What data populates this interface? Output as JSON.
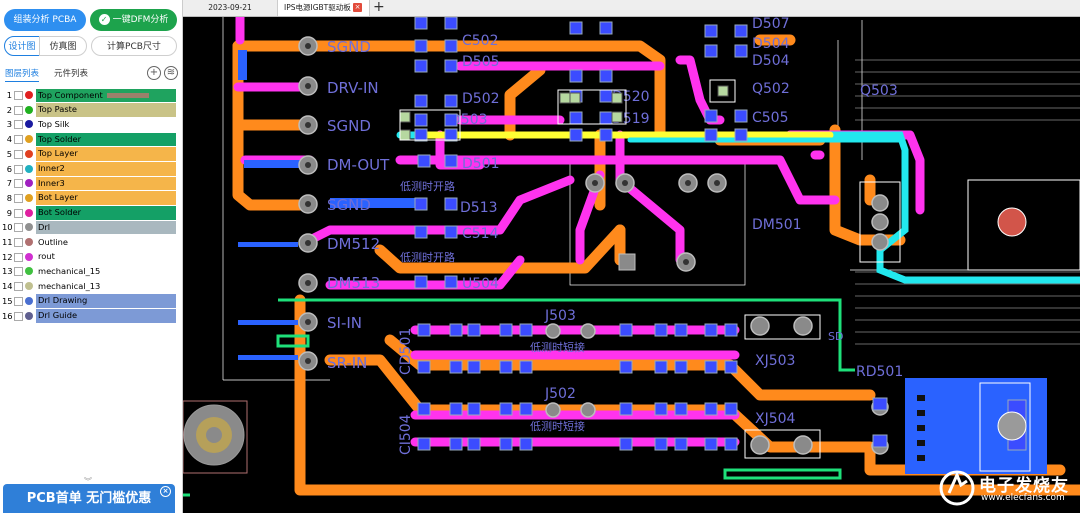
{
  "sidebar": {
    "pcba_button": "组装分析 PCBA",
    "dfm_button": "一键DFM分析",
    "view_tabs": [
      "设计图",
      "仿真图"
    ],
    "calc_button": "计算PCB尺寸",
    "list_tabs": [
      "图层列表",
      "元件列表"
    ],
    "layers": [
      {
        "num": "1",
        "name": "Top Component",
        "dot": "#e02020",
        "bg": "#1fa35f",
        "color": "#000"
      },
      {
        "num": "2",
        "name": "Top Paste",
        "dot": "#20b020",
        "bg": "#c9c387",
        "color": "#000"
      },
      {
        "num": "3",
        "name": "Top Silk",
        "dot": "#1a1aa0",
        "bg": "",
        "color": "#000"
      },
      {
        "num": "4",
        "name": "Top Solder",
        "dot": "#e0a020",
        "bg": "#14a066",
        "color": "#000"
      },
      {
        "num": "5",
        "name": "Top Layer",
        "dot": "#e04020",
        "bg": "#f5b54a",
        "color": "#000"
      },
      {
        "num": "6",
        "name": "Inner2",
        "dot": "#20b0c0",
        "bg": "#f5b54a",
        "color": "#000"
      },
      {
        "num": "7",
        "name": "Inner3",
        "dot": "#a020c0",
        "bg": "#f5b54a",
        "color": "#000"
      },
      {
        "num": "8",
        "name": "Bot Layer",
        "dot": "#e0a020",
        "bg": "#f5b54a",
        "color": "#000"
      },
      {
        "num": "9",
        "name": "Bot Solder",
        "dot": "#e020a0",
        "bg": "#14a066",
        "color": "#000"
      },
      {
        "num": "10",
        "name": "Drl",
        "dot": "#909090",
        "bg": "#a9b8bf",
        "color": "#000"
      },
      {
        "num": "11",
        "name": "Outline",
        "dot": "#b07070",
        "bg": "",
        "color": "#000"
      },
      {
        "num": "12",
        "name": "rout",
        "dot": "#d030d0",
        "bg": "",
        "color": "#000"
      },
      {
        "num": "13",
        "name": "mechanical_15",
        "dot": "#40c040",
        "bg": "",
        "color": "#000"
      },
      {
        "num": "14",
        "name": "mechanical_13",
        "dot": "#c0c090",
        "bg": "",
        "color": "#000"
      },
      {
        "num": "15",
        "name": "Drl Drawing",
        "dot": "#4a6fd0",
        "bg": "#7d9ad6",
        "color": "#000"
      },
      {
        "num": "16",
        "name": "Drl Guide",
        "dot": "#606090",
        "bg": "#7d9ad6",
        "color": "#000"
      }
    ],
    "promo_text": "PCB首单 无门槛优惠",
    "promo_chevron": "︾",
    "promo_close": "×"
  },
  "tabs": {
    "date": "2023-09-21",
    "doc": "IPS电源IGBT驱动板",
    "close_glyph": "×",
    "new_glyph": "+"
  },
  "board": {
    "connector_labels": [
      "SGND",
      "DRV-IN",
      "SGND",
      "DM-OUT",
      "SGND",
      "DM512",
      "DM513",
      "SI-IN",
      "SR-IN"
    ],
    "refs": {
      "c502": "C502",
      "d505": "D505",
      "d502": "D502",
      "d503": "D503",
      "d513": "D513",
      "d501": "D501",
      "c514": "C514",
      "d504": "D504",
      "q502": "Q502",
      "c505": "C505",
      "q503": "Q503",
      "dm501": "DM501",
      "j503": "J503",
      "j502": "J502",
      "xj503": "XJ503",
      "xj504": "XJ504",
      "rd501": "RD501",
      "cd501": "CD501",
      "ci504": "CI504",
      "d507": "D507",
      "d504b": "D504",
      "u504": "U504",
      "d520": "D520",
      "d519": "D519",
      "sd": "SD"
    },
    "notes": {
      "n1": "低测时开路",
      "n2": "低测时开路",
      "n3": "低测时短接",
      "n4": "低测时短接"
    }
  },
  "watermark": {
    "title": "电子发烧友",
    "url": "www.elecfans.com"
  },
  "colors": {
    "orange": "#ff8a1c",
    "magenta": "#ff33ee",
    "cyan": "#22e8ee",
    "yellow": "#ffff33",
    "blue": "#2a62ff",
    "green": "#1ee07a",
    "silk": "#6f6fd8"
  }
}
